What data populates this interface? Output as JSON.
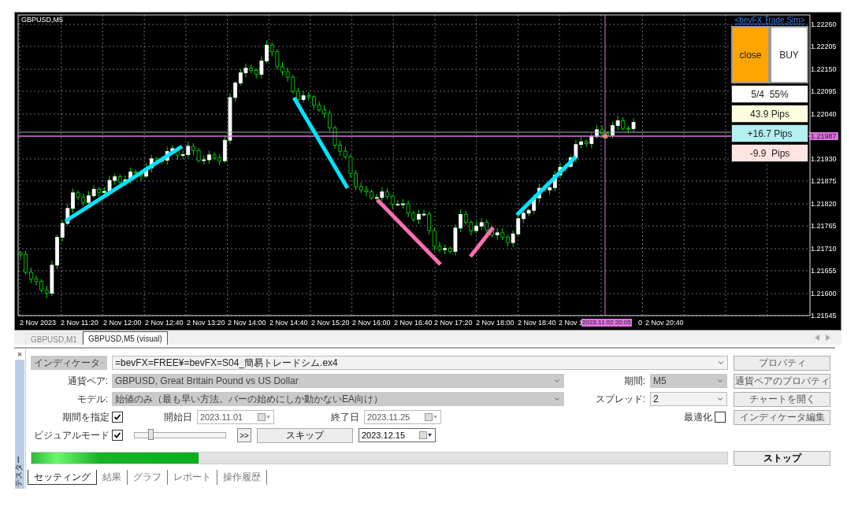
{
  "chart": {
    "symbol_label": "GBPUSD,M5",
    "price_labels": [
      "1.22260",
      "1.22205",
      "1.22150",
      "1.22095",
      "1.22040",
      "1.21930",
      "1.21875",
      "1.21820",
      "1.21765",
      "1.21710",
      "1.21655",
      "1.21600",
      "1.21545"
    ],
    "current_price": "1.21987",
    "time_labels": [
      "2 Nov 2023",
      "2 Nov 11:20",
      "2 Nov 12:00",
      "2 Nov 12:40",
      "2 Nov 13:20",
      "2 Nov 14:00",
      "2 Nov 14:40",
      "2 Nov 15:20",
      "2 Nov 16:00",
      "2 Nov 16:40",
      "2 Nov 17:20",
      "2 Nov 18:00",
      "2 Nov 18:40",
      "2 Nov 1",
      "0",
      "2 Nov 20:40"
    ],
    "cursor_time": "2023.11.02 20:05",
    "panel": {
      "title": "<bevFX Trade Sim>",
      "buttons": [
        {
          "label": "close",
          "kind": "close"
        },
        {
          "label": "BUY",
          "kind": "buy"
        }
      ],
      "stats": [
        {
          "text": "5/4  55%",
          "color": "#ffffff"
        },
        {
          "text": "43.9 Pips",
          "color": "#ffffe0"
        },
        {
          "text": "+16.7 Pips",
          "color": "#b4f0f0"
        },
        {
          "text": "-9.9  Pips",
          "color": "#ffe4e1"
        }
      ]
    }
  },
  "chart_tabs": [
    {
      "label": "GBPUSD,M1",
      "selected": false
    },
    {
      "label": "GBPUSD,M5 (visual)",
      "selected": true
    }
  ],
  "tester": {
    "side_title": "テスター",
    "close_glyph": "×",
    "type_select": {
      "value": "インディケータ",
      "disabled": true
    },
    "program": {
      "value": "=bevFX=FREE¥=bevFX=S04_簡易トレードシム.ex4"
    },
    "symbol": {
      "label": "通貨ペア:",
      "value": "GBPUSD, Great Britain Pound vs US Dollar",
      "disabled": true
    },
    "model": {
      "label": "モデル:",
      "value": "始値のみ（最も早い方法。バーの始めにしか動かないEA向け）",
      "disabled": true
    },
    "period": {
      "label": "期間:",
      "value": "M5",
      "disabled": true
    },
    "spread": {
      "label": "スプレッド:",
      "value": "2",
      "disabled": false
    },
    "use_date": {
      "label": "期間を指定",
      "checked": true
    },
    "from": {
      "label": "開始日",
      "value": "2023.11.01",
      "disabled": true
    },
    "to": {
      "label": "終了日",
      "value": "2023.11.25",
      "disabled": true
    },
    "optimization": {
      "label": "最適化",
      "checked": false
    },
    "visual_mode": {
      "label": "ビジュアルモード",
      "checked": true
    },
    "speed": {
      "level": 0.17
    },
    "fast_forward": ">>",
    "skip": "スキップ",
    "skip_to": {
      "value": "2023.12.15",
      "disabled": false
    },
    "progress": {
      "level": 0.24
    },
    "buttons": [
      {
        "label": "プロパティ",
        "disabled": true
      },
      {
        "label": "通貨ペアのプロパティ",
        "disabled": true
      },
      {
        "label": "チャートを開く",
        "disabled": true
      },
      {
        "label": "インディケータ編集",
        "disabled": true
      }
    ],
    "stop": "ストップ",
    "tabs": [
      {
        "label": "セッティング",
        "selected": true
      },
      {
        "label": "結果",
        "selected": false
      },
      {
        "label": "グラフ",
        "selected": false
      },
      {
        "label": "レポート",
        "selected": false
      },
      {
        "label": "操作履歴",
        "selected": false
      }
    ]
  }
}
